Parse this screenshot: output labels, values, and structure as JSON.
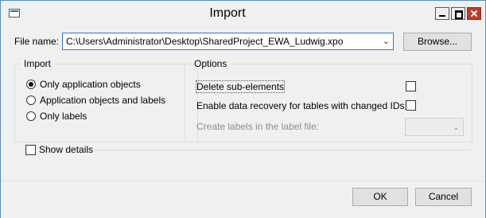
{
  "window": {
    "title": "Import"
  },
  "titlebar_icons": [
    "app-icon",
    "minimize-icon",
    "maximize-icon",
    "close-icon"
  ],
  "file": {
    "label": "File name:",
    "value": "C:\\Users\\Administrator\\Desktop\\SharedProject_EWA_Ludwig.xpo"
  },
  "browse_label": "Browse...",
  "import_group": {
    "title": "Import",
    "options": [
      "Only application objects",
      "Application objects and labels",
      "Only labels"
    ],
    "selected": "Only application objects"
  },
  "options_group": {
    "title": "Options",
    "delete_sub": {
      "label": "Delete sub-elements",
      "checked": false
    },
    "data_recovery": {
      "label": "Enable data recovery for tables with changed IDs:",
      "checked": false
    },
    "labels_file": {
      "label": "Create labels in the label file:",
      "value": "",
      "enabled": false
    }
  },
  "show_details": {
    "label": "Show details",
    "checked": false
  },
  "ok_label": "OK",
  "cancel_label": "Cancel",
  "colors": {
    "accent_border": "#2b79c2",
    "close_button": "#c0392b"
  }
}
